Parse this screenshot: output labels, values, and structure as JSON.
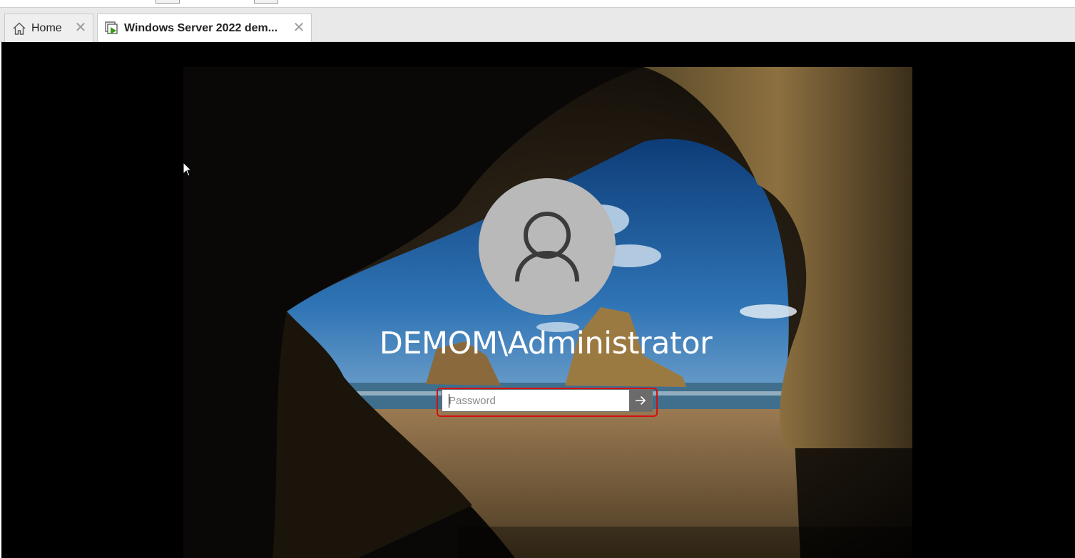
{
  "tabs": [
    {
      "label": "Home",
      "icon": "home-icon",
      "active": false
    },
    {
      "label": "Windows Server 2022 dem...",
      "icon": "vm-play-icon",
      "active": true
    }
  ],
  "login": {
    "username": "DEMOM\\Administrator",
    "password_placeholder": "Password",
    "password_value": "",
    "submit_icon": "arrow-right-icon"
  },
  "colors": {
    "highlight": "#d40f0f",
    "avatar": "#b9b9b9",
    "vm_icon_accent": "#3a9a1c"
  }
}
